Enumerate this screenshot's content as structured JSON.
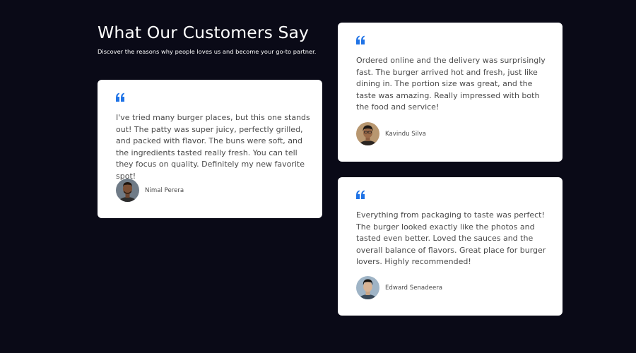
{
  "section": {
    "title": "What Our Customers Say",
    "subtitle": "Discover the reasons why people loves us and become your go-to partner."
  },
  "colors": {
    "page_background": "#0a0a17",
    "card_background": "#ffffff",
    "quote_accent": "#1f73e6",
    "body_text": "#4a4a4a"
  },
  "testimonials": [
    {
      "quote": "I've tried many burger places, but this one stands out! The patty was super juicy, perfectly grilled, and packed with flavor. The buns were soft, and the ingredients tasted really fresh. You can tell they focus on quality. Definitely my new favorite spot!",
      "author": "Nimal Perera",
      "icon": "quote-icon"
    },
    {
      "quote": "Ordered online and the delivery was surprisingly fast. The burger arrived hot and fresh, just like dining in. The portion size was great, and the taste was amazing. Really impressed with both the food and service!",
      "author": "Kavindu Silva",
      "icon": "quote-icon"
    },
    {
      "quote": "Everything from packaging to taste was perfect! The burger looked exactly like the photos and tasted even better. Loved the sauces and the overall balance of flavors. Great place for burger lovers. Highly recommended!",
      "author": "Edward Senadeera",
      "icon": "quote-icon"
    }
  ]
}
